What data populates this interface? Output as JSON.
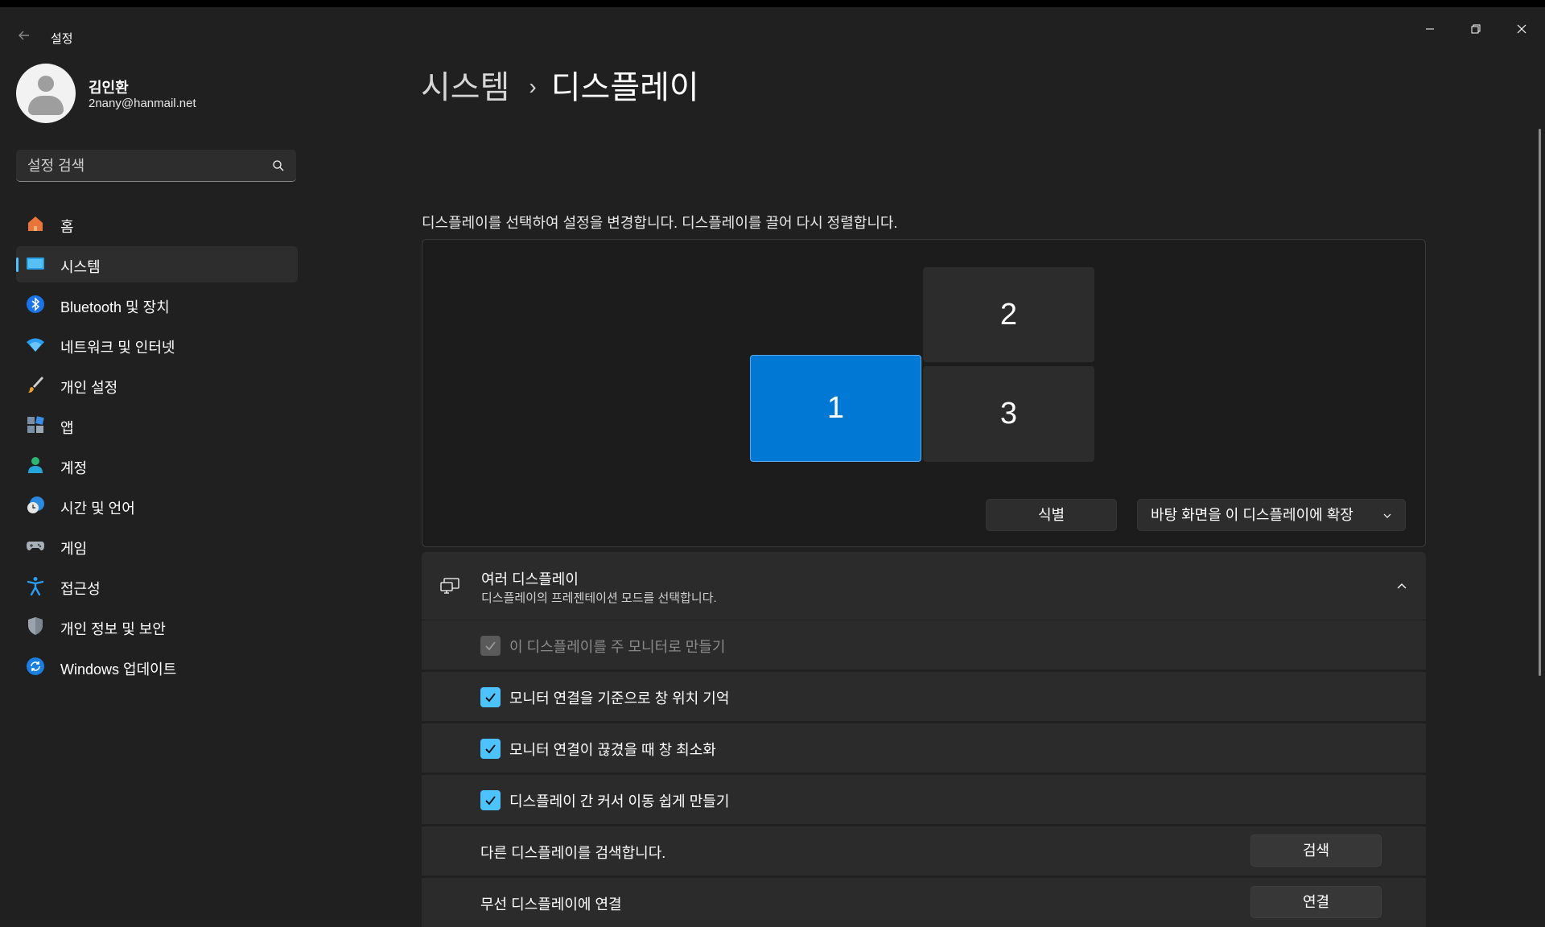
{
  "window": {
    "title": "설정",
    "back_icon": "back-arrow-icon",
    "controls": {
      "minimize": "─",
      "maximize": "❐",
      "close": "✕"
    }
  },
  "profile": {
    "name": "김인환",
    "email": "2nany@hanmail.net"
  },
  "search": {
    "placeholder": "설정 검색",
    "icon": "search-icon"
  },
  "sidebar": {
    "items": [
      {
        "label": "홈",
        "icon": "home-icon",
        "active": false
      },
      {
        "label": "시스템",
        "icon": "system-monitor-icon",
        "active": true
      },
      {
        "label": "Bluetooth 및 장치",
        "icon": "bluetooth-icon",
        "active": false
      },
      {
        "label": "네트워크 및 인터넷",
        "icon": "wifi-icon",
        "active": false
      },
      {
        "label": "개인 설정",
        "icon": "paintbrush-icon",
        "active": false
      },
      {
        "label": "앱",
        "icon": "apps-icon",
        "active": false
      },
      {
        "label": "계정",
        "icon": "account-icon",
        "active": false
      },
      {
        "label": "시간 및 언어",
        "icon": "clock-globe-icon",
        "active": false
      },
      {
        "label": "게임",
        "icon": "gamepad-icon",
        "active": false
      },
      {
        "label": "접근성",
        "icon": "accessibility-icon",
        "active": false
      },
      {
        "label": "개인 정보 및 보안",
        "icon": "shield-icon",
        "active": false
      },
      {
        "label": "Windows 업데이트",
        "icon": "update-icon",
        "active": false
      }
    ]
  },
  "breadcrumb": {
    "parent": "시스템",
    "separator": "›",
    "current": "디스플레이"
  },
  "display": {
    "hint": "디스플레이를 선택하여 설정을 변경합니다. 디스플레이를 끌어 다시 정렬합니다.",
    "monitors": [
      {
        "label": "1",
        "selected": true
      },
      {
        "label": "2",
        "selected": false
      },
      {
        "label": "3",
        "selected": false
      }
    ],
    "identify_button": "식별",
    "mode_dropdown": "바탕 화면을 이 디스플레이에 확장"
  },
  "multi_display": {
    "title": "여러 디스플레이",
    "subtitle": "디스플레이의 프레젠테이션 모드를 선택합니다.",
    "expanded": true,
    "options": [
      {
        "label": "이 디스플레이를 주 모니터로 만들기",
        "checked": true,
        "disabled": true
      },
      {
        "label": "모니터 연결을 기준으로 창 위치 기억",
        "checked": true,
        "disabled": false
      },
      {
        "label": "모니터 연결이 끊겼을 때 창 최소화",
        "checked": true,
        "disabled": false
      },
      {
        "label": "디스플레이 간 커서 이동 쉽게 만들기",
        "checked": true,
        "disabled": false
      }
    ],
    "detect": {
      "label": "다른 디스플레이를 검색합니다.",
      "button": "검색"
    },
    "wireless": {
      "label": "무선 디스플레이에 연결",
      "button": "연결"
    }
  },
  "colors": {
    "accent": "#4cc2ff",
    "selected_monitor": "#0078d4",
    "background": "#202020",
    "card": "#2b2b2b"
  }
}
